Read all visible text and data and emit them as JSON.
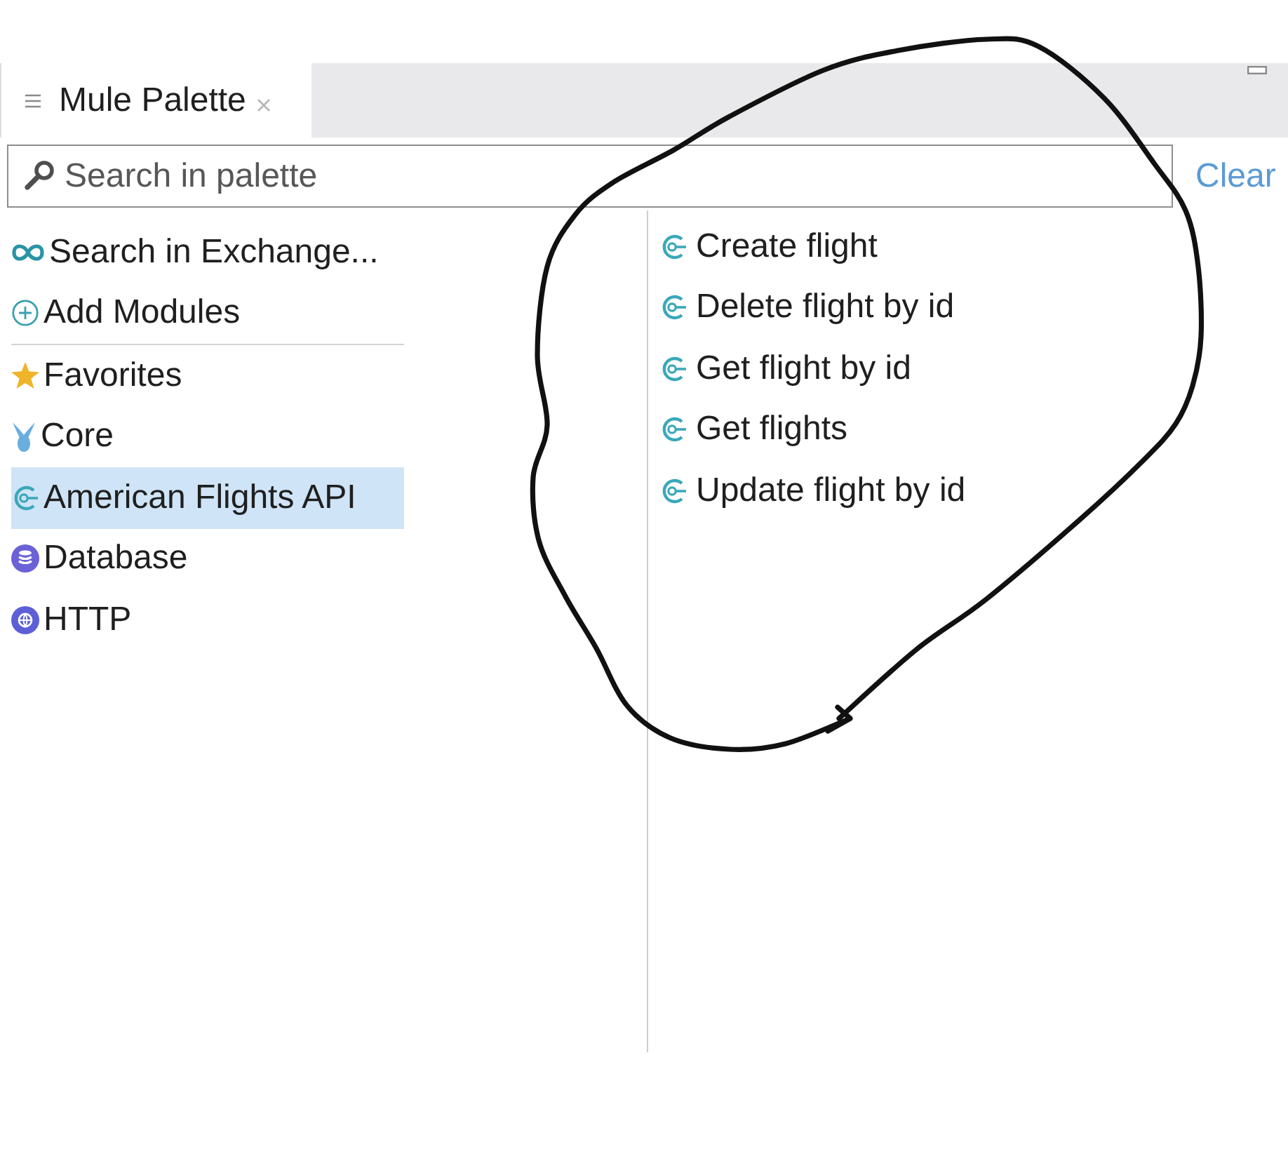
{
  "tabs": [
    {
      "label": "Mule Palette",
      "selected": true
    }
  ],
  "search": {
    "placeholder": "Search in palette",
    "clear": "Clear"
  },
  "actions": [
    {
      "label": "Search in Exchange...",
      "kind": "exchange"
    },
    {
      "label": "Add Modules",
      "kind": "add"
    }
  ],
  "modules": [
    {
      "label": "Favorites",
      "kind": "favorites",
      "selected": false
    },
    {
      "label": "Core",
      "kind": "core",
      "selected": false
    },
    {
      "label": "American Flights API",
      "kind": "connector",
      "selected": true
    },
    {
      "label": "Database",
      "kind": "database",
      "selected": false
    },
    {
      "label": "HTTP",
      "kind": "http",
      "selected": false
    }
  ],
  "operations": [
    {
      "label": "Create flight",
      "kind": "connector",
      "selected": false
    },
    {
      "label": "Delete flight by id",
      "kind": "connector",
      "selected": false
    },
    {
      "label": "Get flight by id",
      "kind": "connector",
      "selected": false
    },
    {
      "label": "Get flights",
      "kind": "connector",
      "selected": false
    },
    {
      "label": "Update flight by id",
      "kind": "connector",
      "selected": false
    }
  ]
}
